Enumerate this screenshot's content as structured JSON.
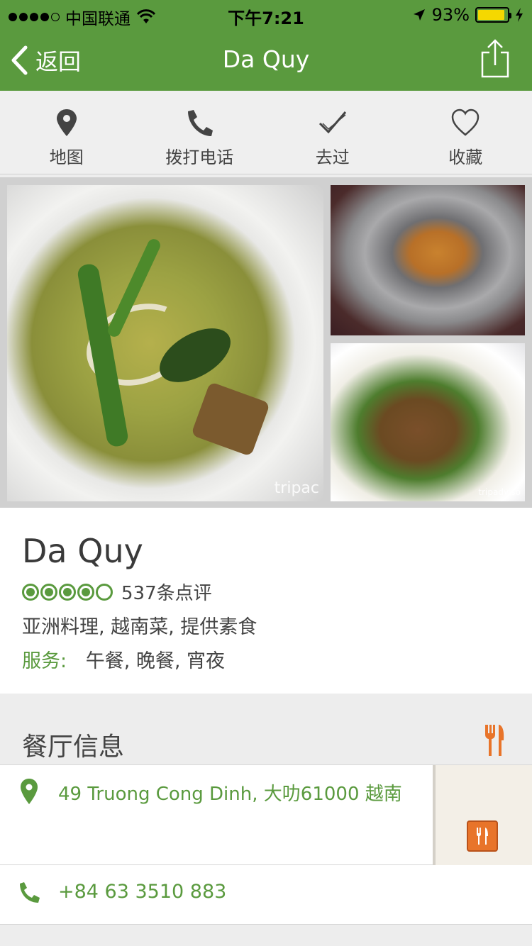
{
  "status_bar": {
    "carrier": "中国联通",
    "time": "下午7:21",
    "battery": "93%",
    "battery_level": 0.93,
    "signal_bars": 4
  },
  "nav": {
    "back_label": "返回",
    "title": "Da Quy"
  },
  "actions": [
    {
      "label": "地图",
      "icon": "map-pin-icon"
    },
    {
      "label": "拨打电话",
      "icon": "phone-icon"
    },
    {
      "label": "去过",
      "icon": "checkmark-icon"
    },
    {
      "label": "收藏",
      "icon": "heart-icon"
    }
  ],
  "photos": {
    "watermark_main": "tripac",
    "watermark_small": "tripadviso"
  },
  "restaurant": {
    "name": "Da Quy",
    "rating_bubbles": 4,
    "rating_max": 5,
    "reviews": "537条点评",
    "cuisine": "亚洲料理, 越南菜, 提供素食",
    "service_label": "服务:",
    "service_value": "午餐, 晚餐, 宵夜"
  },
  "section": {
    "title": "餐厅信息"
  },
  "address": "49 Truong Cong Dinh, 大叻61000 越南",
  "phone": "+84 63 3510 883",
  "colors": {
    "brand_green": "#5a9a3e",
    "accent_orange": "#e8742a",
    "battery_yellow": "#f5d800"
  }
}
